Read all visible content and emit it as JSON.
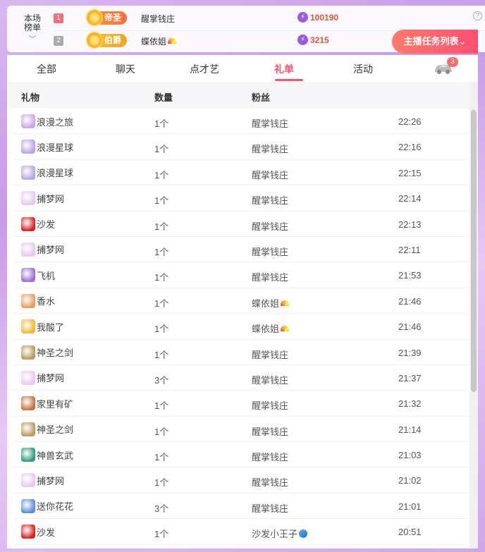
{
  "rank": {
    "title_line1": "本场",
    "title_line2": "榜单",
    "rows": [
      {
        "num": "1",
        "badge": "帝圣",
        "name": "醒掌钱庄",
        "score": "100190"
      },
      {
        "num": "2",
        "badge": "伯爵",
        "name": "蝶依姐",
        "score": "3215"
      }
    ]
  },
  "tabs": [
    "全部",
    "聊天",
    "点才艺",
    "礼单",
    "活动"
  ],
  "active_tab": "礼单",
  "car_badge": "3",
  "task_button": "主播任务列表",
  "table": {
    "headers": [
      "礼物",
      "数量",
      "粉丝"
    ],
    "rows": [
      {
        "gift": "浪漫之旅",
        "qty": "1个",
        "fan": "醒掌钱庄",
        "time": "22:26",
        "icon": "journey",
        "rainbow": false
      },
      {
        "gift": "浪漫星球",
        "qty": "1个",
        "fan": "醒掌钱庄",
        "time": "22:16",
        "icon": "planet",
        "rainbow": false
      },
      {
        "gift": "浪漫星球",
        "qty": "1个",
        "fan": "醒掌钱庄",
        "time": "22:15",
        "icon": "planet",
        "rainbow": false
      },
      {
        "gift": "捕梦网",
        "qty": "1个",
        "fan": "醒掌钱庄",
        "time": "22:14",
        "icon": "dreamcatcher",
        "rainbow": false
      },
      {
        "gift": "沙发",
        "qty": "1个",
        "fan": "醒掌钱庄",
        "time": "22:13",
        "icon": "sofa",
        "rainbow": false
      },
      {
        "gift": "捕梦网",
        "qty": "1个",
        "fan": "醒掌钱庄",
        "time": "22:11",
        "icon": "dreamcatcher",
        "rainbow": false
      },
      {
        "gift": "飞机",
        "qty": "1个",
        "fan": "醒掌钱庄",
        "time": "21:53",
        "icon": "plane",
        "rainbow": false
      },
      {
        "gift": "香水",
        "qty": "1个",
        "fan": "蝶依姐",
        "time": "21:46",
        "icon": "perfume",
        "rainbow": true
      },
      {
        "gift": "我酸了",
        "qty": "1个",
        "fan": "蝶依姐",
        "time": "21:46",
        "icon": "lemon",
        "rainbow": true
      },
      {
        "gift": "神圣之剑",
        "qty": "1个",
        "fan": "醒掌钱庄",
        "time": "21:39",
        "icon": "sword",
        "rainbow": false
      },
      {
        "gift": "捕梦网",
        "qty": "3个",
        "fan": "醒掌钱庄",
        "time": "21:37",
        "icon": "dreamcatcher",
        "rainbow": false
      },
      {
        "gift": "家里有矿",
        "qty": "1个",
        "fan": "醒掌钱庄",
        "time": "21:32",
        "icon": "mine",
        "rainbow": false
      },
      {
        "gift": "神圣之剑",
        "qty": "1个",
        "fan": "醒掌钱庄",
        "time": "21:14",
        "icon": "sword",
        "rainbow": false
      },
      {
        "gift": "神兽玄武",
        "qty": "1个",
        "fan": "醒掌钱庄",
        "time": "21:03",
        "icon": "turtle",
        "rainbow": false
      },
      {
        "gift": "捕梦网",
        "qty": "1个",
        "fan": "醒掌钱庄",
        "time": "21:02",
        "icon": "dreamcatcher",
        "rainbow": false
      },
      {
        "gift": "送你花花",
        "qty": "3个",
        "fan": "醒掌钱庄",
        "time": "21:01",
        "icon": "flower",
        "rainbow": false
      },
      {
        "gift": "沙发",
        "qty": "1个",
        "fan": "沙发小王子",
        "time": "20:51",
        "icon": "sofa",
        "rainbow": false
      }
    ]
  },
  "icon_colors": {
    "journey": "#c9a4e8",
    "planet": "#b9a4e6",
    "dreamcatcher": "#e8c8ee",
    "sofa": "#d81e1e",
    "plane": "#9b6ad8",
    "perfume": "#e89a5c",
    "lemon": "#f0b830",
    "sword": "#b89a5a",
    "mine": "#c87040",
    "turtle": "#2e9a7a",
    "flower": "#5a8ae0"
  }
}
